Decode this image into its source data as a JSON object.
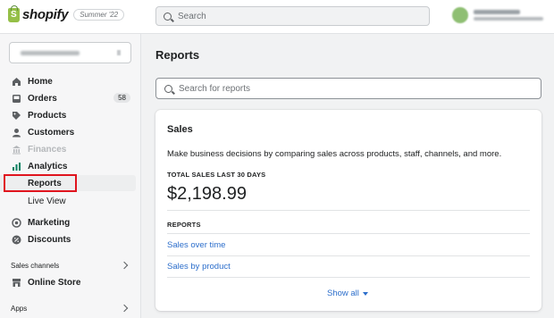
{
  "brand": {
    "name": "shopify",
    "edition": "Summer '22"
  },
  "topbar": {
    "search_placeholder": "Search"
  },
  "sidebar": {
    "items": [
      {
        "label": "Home",
        "icon": "home-icon"
      },
      {
        "label": "Orders",
        "icon": "orders-icon",
        "count": "58"
      },
      {
        "label": "Products",
        "icon": "tag-icon"
      },
      {
        "label": "Customers",
        "icon": "person-icon"
      },
      {
        "label": "Finances",
        "icon": "bank-icon",
        "disabled": true
      },
      {
        "label": "Analytics",
        "icon": "analytics-icon"
      },
      {
        "label": "Reports",
        "active": true
      },
      {
        "label": "Live View"
      },
      {
        "label": "Marketing",
        "icon": "target-icon"
      },
      {
        "label": "Discounts",
        "icon": "discount-icon"
      }
    ],
    "sales_channels_label": "Sales channels",
    "online_store_label": "Online Store",
    "apps_label": "Apps"
  },
  "main": {
    "title": "Reports",
    "search_placeholder": "Search for reports",
    "card": {
      "title": "Sales",
      "description": "Make business decisions by comparing sales across products, staff, channels, and more.",
      "metric_label": "TOTAL SALES LAST 30 DAYS",
      "metric_value": "$2,198.99",
      "reports_label": "REPORTS",
      "links": [
        "Sales over time",
        "Sales by product"
      ],
      "show_all": "Show all"
    }
  },
  "colors": {
    "accent_link": "#2c6ecb",
    "highlight_red": "#e0141e",
    "analytics_green": "#008060"
  }
}
